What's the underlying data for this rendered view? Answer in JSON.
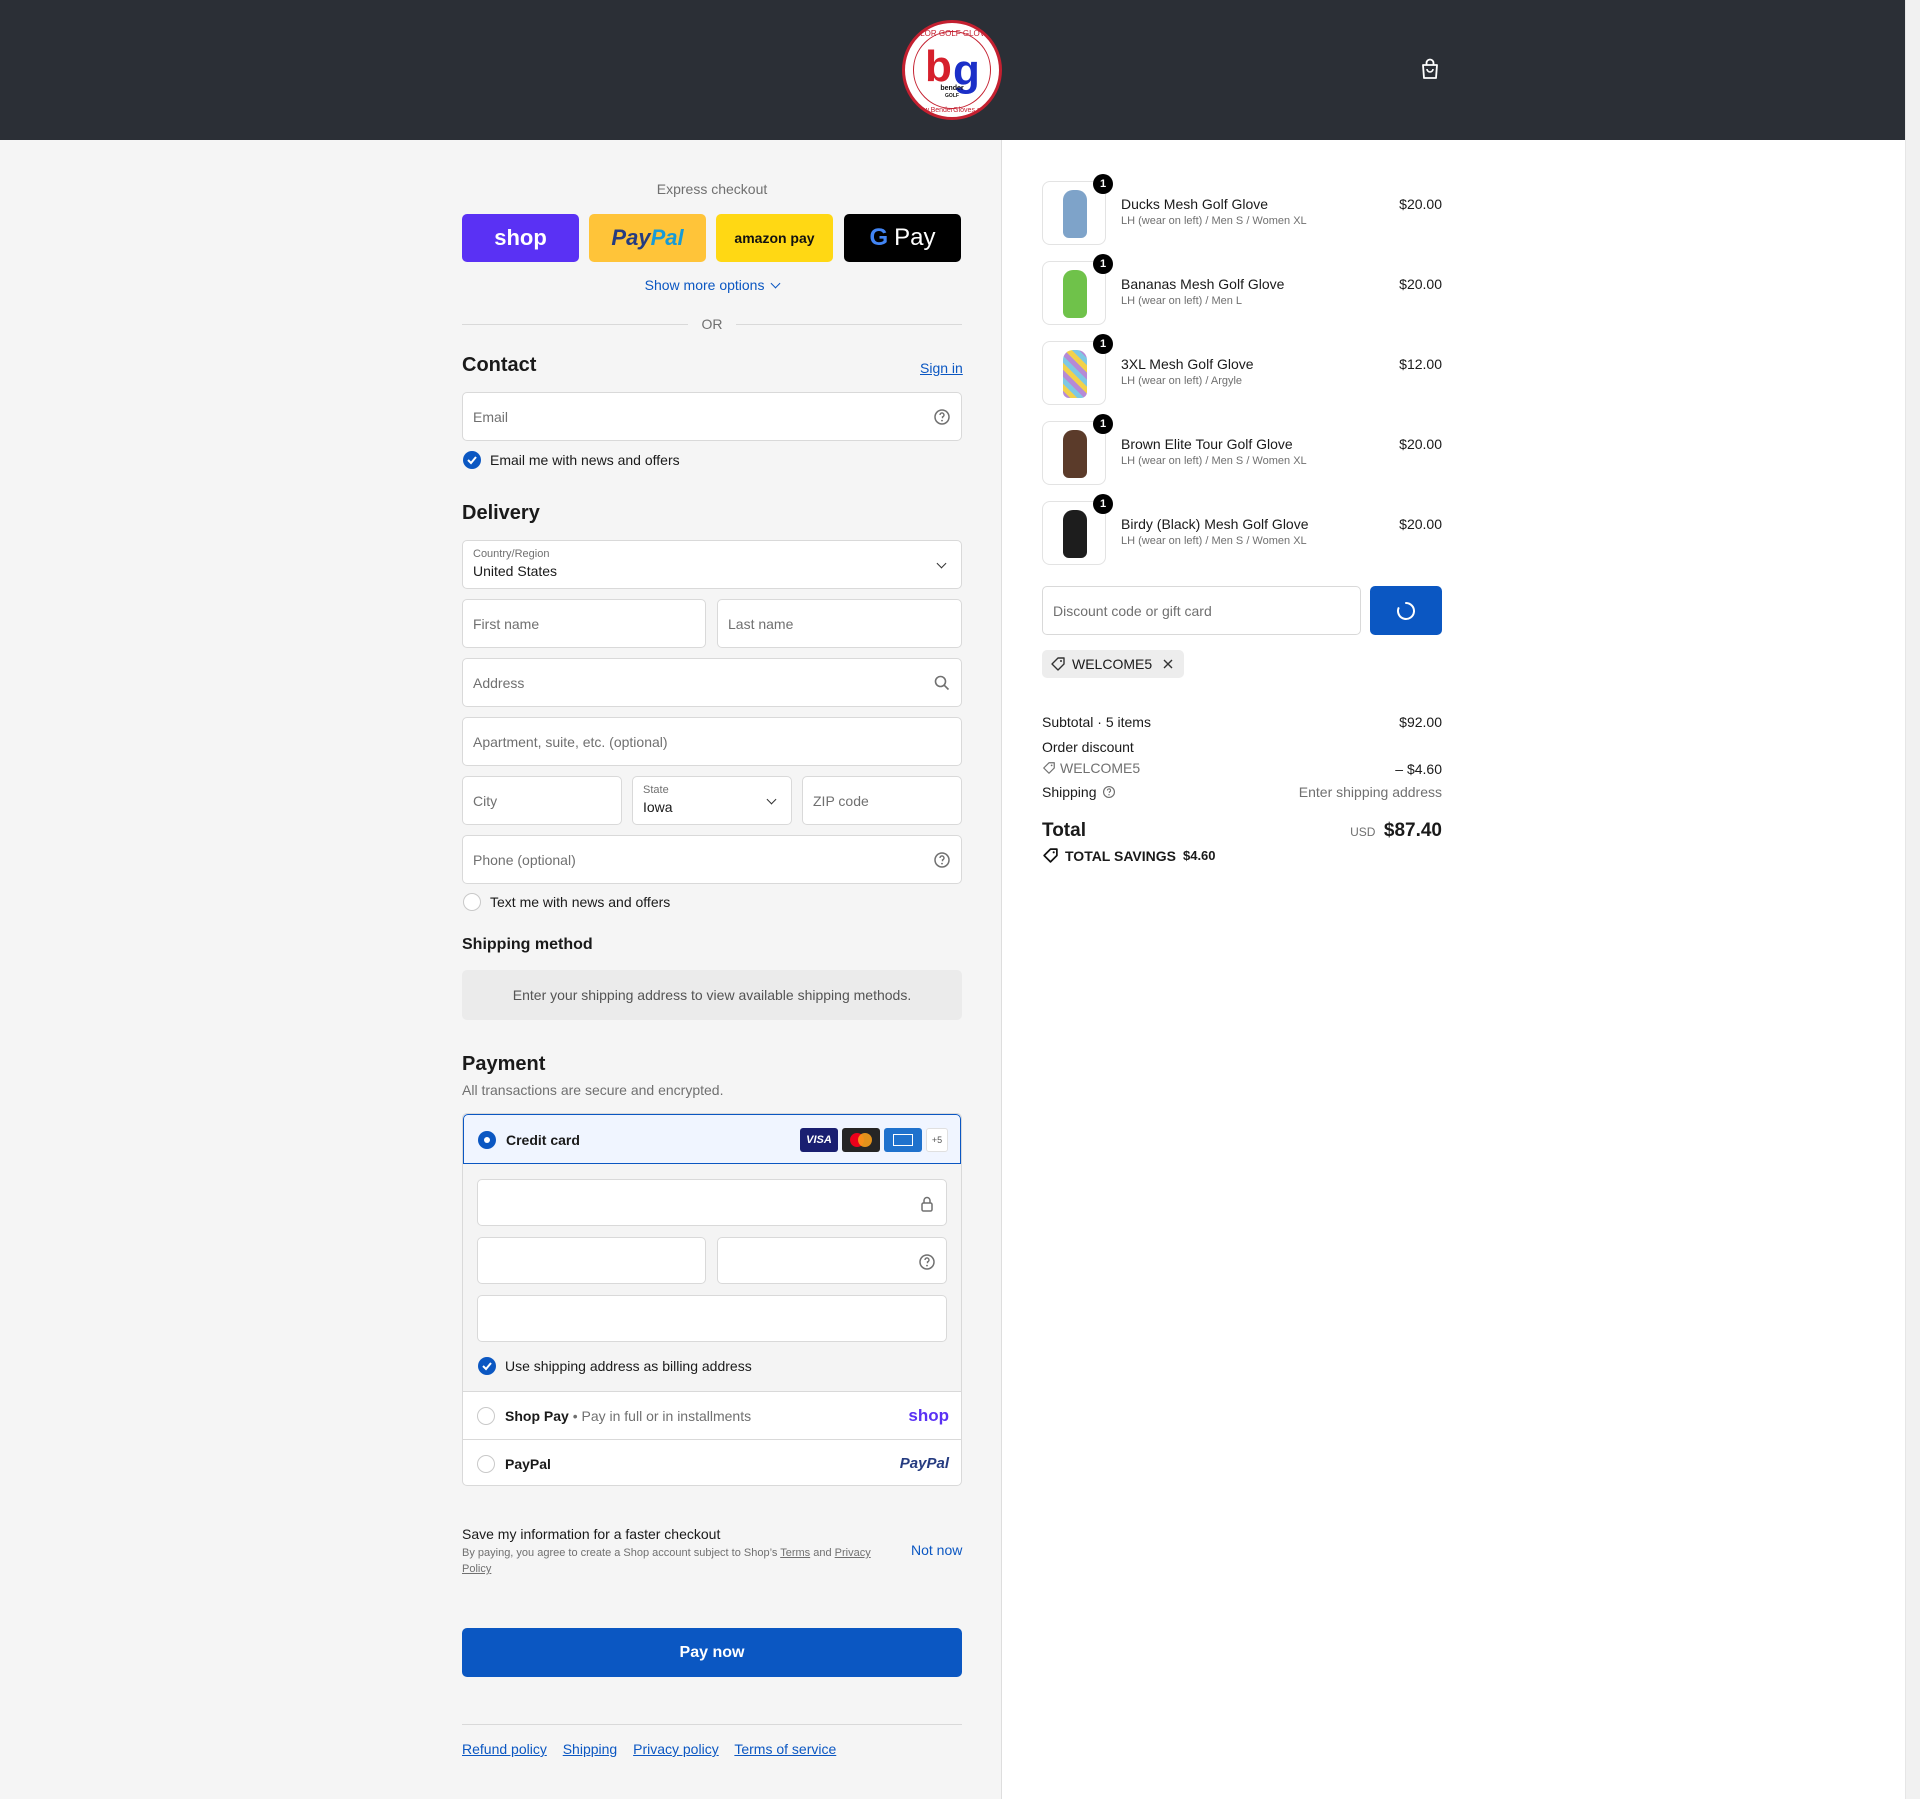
{
  "header": {
    "logo_top_text": "COLOR GOLF GLOVES",
    "logo_brand": "bender",
    "logo_sub": "GOLF",
    "logo_bottom_text": "www.BenderGloves.com",
    "logo_b": "b",
    "logo_g": "g"
  },
  "express": {
    "title": "Express checkout",
    "shop_label": "shop",
    "paypal_label_a": "Pay",
    "paypal_label_b": "Pal",
    "amazon_label": "amazon pay",
    "gpay_label": "Pay",
    "more_options": "Show more options",
    "or": "OR"
  },
  "contact": {
    "heading": "Contact",
    "sign_in": "Sign in",
    "email_placeholder": "Email",
    "news_label": "Email me with news and offers"
  },
  "delivery": {
    "heading": "Delivery",
    "country_label": "Country/Region",
    "country_value": "United States",
    "first_name": "First name",
    "last_name": "Last name",
    "address": "Address",
    "apartment": "Apartment, suite, etc. (optional)",
    "city": "City",
    "state_label": "State",
    "state_value": "Iowa",
    "zip": "ZIP code",
    "phone": "Phone (optional)",
    "text_me": "Text me with news and offers"
  },
  "shipping_method": {
    "heading": "Shipping method",
    "notice": "Enter your shipping address to view available shipping methods."
  },
  "payment": {
    "heading": "Payment",
    "subtitle": "All transactions are secure and encrypted.",
    "credit_card": "Credit card",
    "card_visa": "VISA",
    "card_more": "+5",
    "billing_same": "Use shipping address as billing address",
    "shop_pay": "Shop Pay",
    "shop_pay_sub": "Pay in full or in installments",
    "shop_logo": "shop",
    "paypal": "PayPal",
    "paypal_logo": "PayPal"
  },
  "save_info": {
    "title": "Save my information for a faster checkout",
    "terms_prefix": "By paying, you agree to create a Shop account subject to Shop’s",
    "terms": "Terms",
    "and": "and",
    "privacy": "Privacy Policy",
    "not_now": "Not now"
  },
  "pay_now": "Pay now",
  "footer_links": [
    "Refund policy",
    "Shipping",
    "Privacy policy",
    "Terms of service"
  ],
  "cart": {
    "items": [
      {
        "name": "Ducks Mesh Golf Glove",
        "variant": "LH (wear on left) / Men S / Women XL",
        "price": "$20.00",
        "qty": "1",
        "color": "#7ea3c9"
      },
      {
        "name": "Bananas Mesh Golf Glove",
        "variant": "LH (wear on left) / Men L",
        "price": "$20.00",
        "qty": "1",
        "color": "#6fc24a"
      },
      {
        "name": "3XL Mesh Golf Glove",
        "variant": "LH (wear on left) / Argyle",
        "price": "$12.00",
        "qty": "1",
        "color": "#b58ad6"
      },
      {
        "name": "Brown Elite Tour Golf Glove",
        "variant": "LH (wear on left) / Men S / Women XL",
        "price": "$20.00",
        "qty": "1",
        "color": "#5b3b2a"
      },
      {
        "name": "Birdy (Black) Mesh Golf Glove",
        "variant": "LH (wear on left) / Men S / Women XL",
        "price": "$20.00",
        "qty": "1",
        "color": "#1d1d1d"
      }
    ],
    "discount_placeholder": "Discount code or gift card",
    "applied_code": "WELCOME5",
    "subtotal_label": "Subtotal · 5 items",
    "subtotal_value": "$92.00",
    "order_discount": "Order discount",
    "discount_code": "WELCOME5",
    "discount_value": "– $4.60",
    "shipping_label": "Shipping",
    "shipping_value": "Enter shipping address",
    "total_label": "Total",
    "currency": "USD",
    "total_value": "$87.40",
    "savings_label": "TOTAL SAVINGS",
    "savings_value": "$4.60"
  }
}
